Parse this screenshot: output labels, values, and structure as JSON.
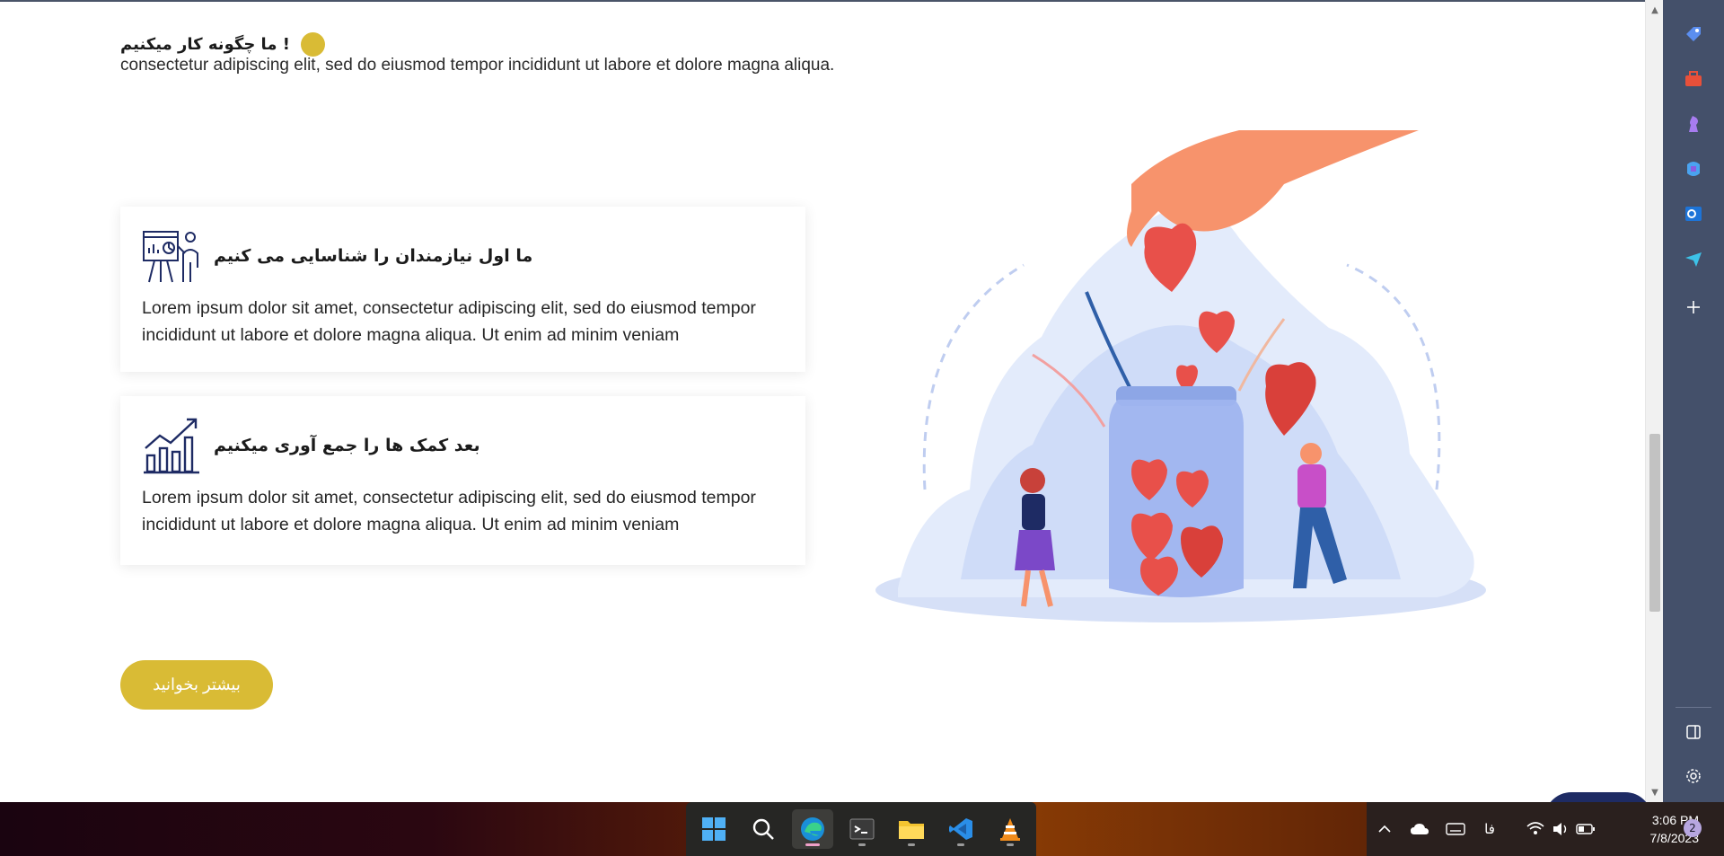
{
  "section": {
    "title": "! ما چگونه کار میکنیم",
    "subtitle": "consectetur adipiscing elit, sed do eiusmod tempor incididunt ut labore et dolore magna aliqua."
  },
  "cards": [
    {
      "title": "ما اول نیازمندان را شناسایی می کنیم",
      "body": "Lorem ipsum dolor sit amet, consectetur adipiscing elit, sed do eiusmod tempor incididunt ut labore et dolore magna aliqua. Ut enim ad minim veniam",
      "icon": "presentation-board-icon"
    },
    {
      "title": "بعد کمک ها را جمع آوری میکنیم",
      "body": "Lorem ipsum dolor sit amet, consectetur adipiscing elit, sed do eiusmod tempor incididunt ut labore et dolore magna aliqua. Ut enim ad minim veniam",
      "icon": "growth-chart-icon"
    }
  ],
  "read_more_label": "بیشتر بخوانید",
  "colors": {
    "accent": "#d9bb35",
    "sidebar": "#44506a",
    "card_icon": "#1e2b64",
    "heart": "#e8504a"
  },
  "sidebar_icons": [
    "tag-icon",
    "toolbox-icon",
    "chess-icon",
    "copilot-icon",
    "outlook-icon",
    "send-icon",
    "add-icon",
    "split-screen-icon",
    "settings-icon"
  ],
  "taskbar": {
    "apps": [
      "windows-start-icon",
      "search-icon",
      "edge-icon",
      "terminal-icon",
      "file-explorer-icon",
      "vscode-icon",
      "vlc-icon"
    ],
    "tray": {
      "language": "فا",
      "time": "3:06 PM",
      "date": "7/8/2023",
      "notifications": "2"
    }
  }
}
